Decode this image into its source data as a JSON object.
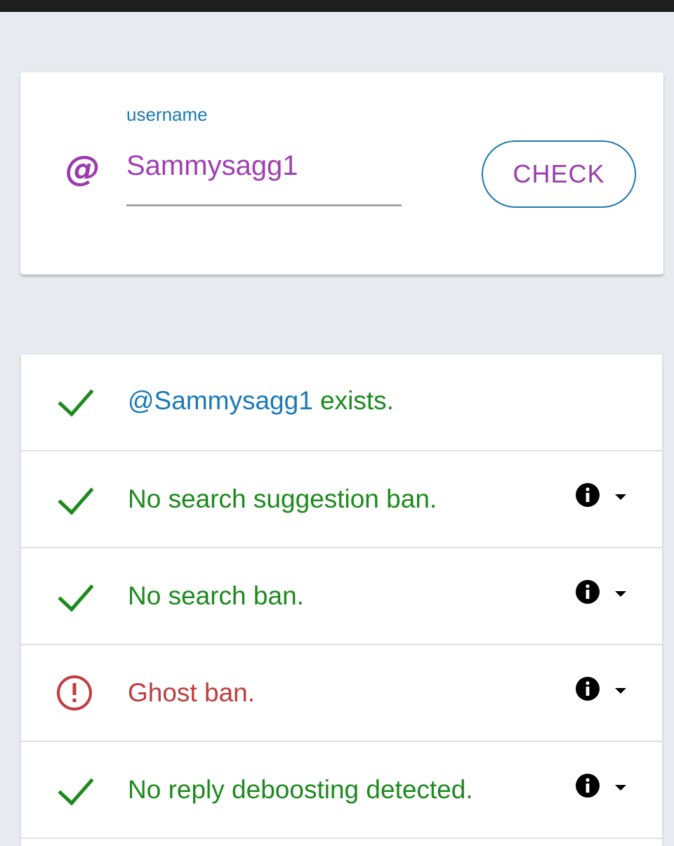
{
  "form": {
    "field_label": "username",
    "at_symbol": "@",
    "username_value": "Sammysagg1",
    "check_label": "CHECK",
    "icon": "at-icon"
  },
  "results": {
    "exists": {
      "icon": "check-icon",
      "handle": "@Sammysagg1",
      "text": " exists."
    },
    "items": [
      {
        "icon": "check-icon",
        "text": "No search suggestion ban.",
        "status": "ok",
        "info_icon": "info-icon",
        "expand_icon": "caret-down-icon"
      },
      {
        "icon": "check-icon",
        "text": "No search ban.",
        "status": "ok",
        "info_icon": "info-icon",
        "expand_icon": "caret-down-icon"
      },
      {
        "icon": "alert-circle-icon",
        "text": "Ghost ban.",
        "status": "bad",
        "info_icon": "info-icon",
        "expand_icon": "caret-down-icon"
      },
      {
        "icon": "check-icon",
        "text": "No reply deboosting detected.",
        "status": "ok",
        "info_icon": "info-icon",
        "expand_icon": "caret-down-icon"
      }
    ]
  },
  "colors": {
    "ok_green": "#1d8a1d",
    "bad_red": "#c13c3c",
    "link_blue": "#1a79b6",
    "accent_purple": "#9c3bae",
    "background": "#e7ebef"
  }
}
